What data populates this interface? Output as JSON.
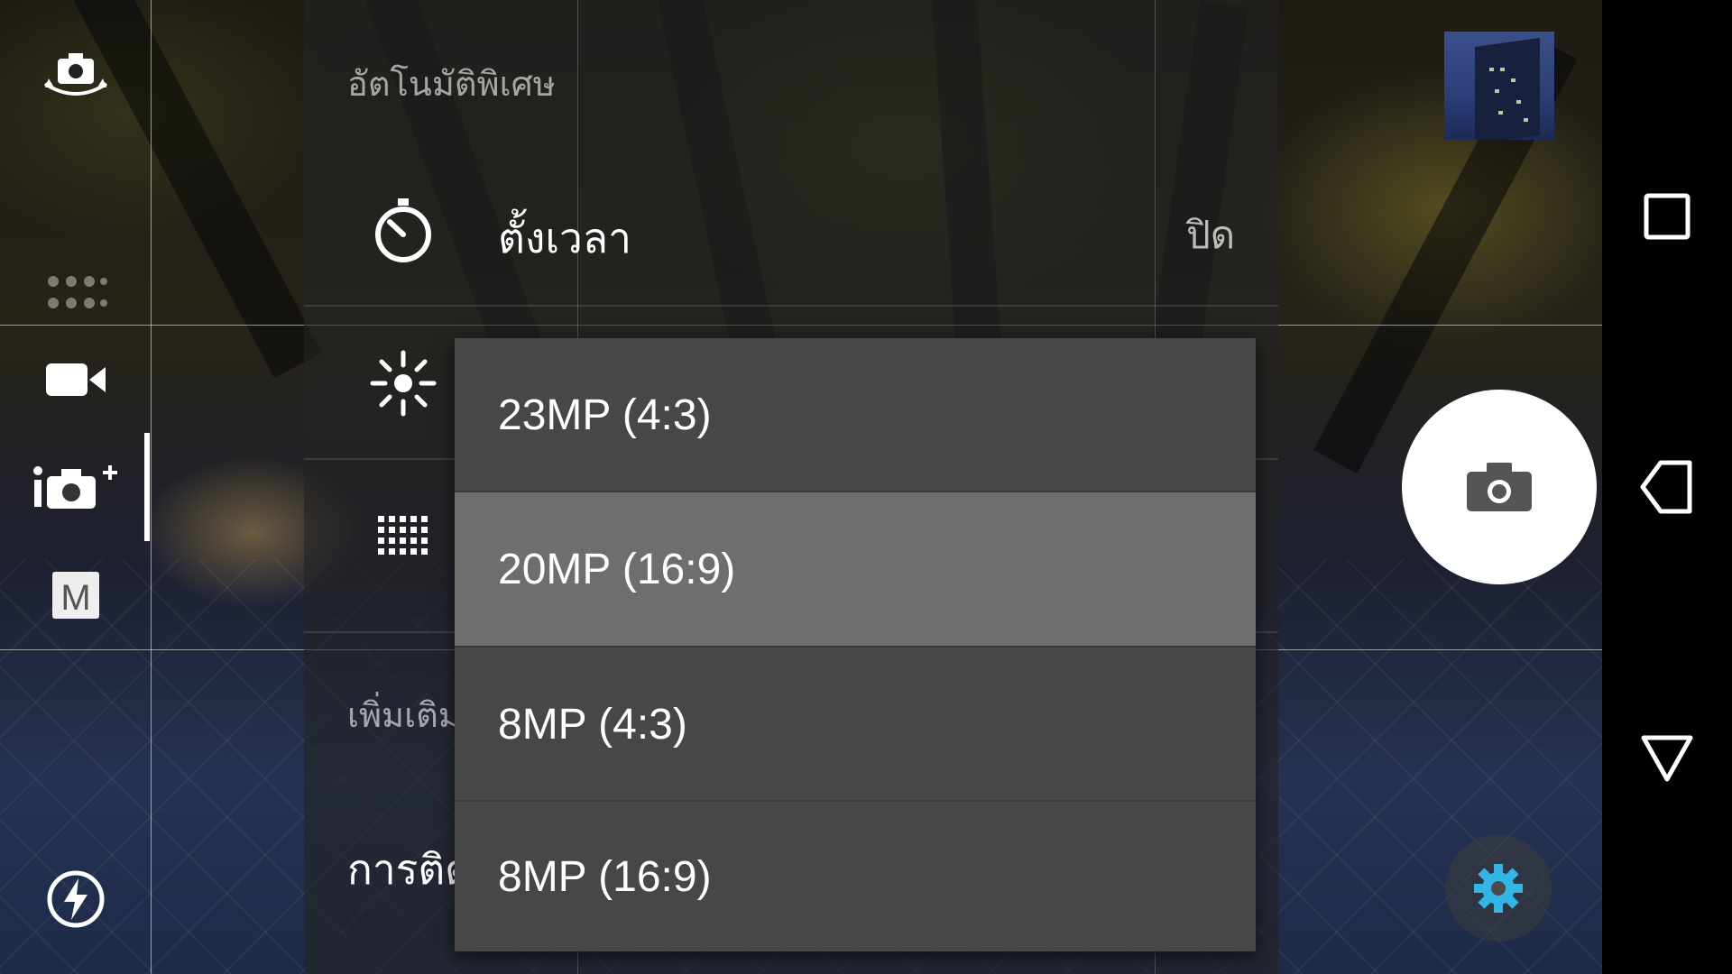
{
  "app": {
    "name": "Camera"
  },
  "rail": {
    "icons": [
      "switch-camera-icon",
      "grid-dots-icon",
      "video-mode-icon",
      "superior-auto-icon",
      "manual-mode-icon",
      "flash-auto-icon"
    ],
    "manual_label": "M"
  },
  "settings": {
    "section_superior_auto": "อัตโนมัติพิเศษ",
    "timer": {
      "label": "ตั้งเวลา",
      "value": "ปิด",
      "icon": "timer-icon"
    },
    "brightness_icon": "brightness-icon",
    "resolution_icon": "resolution-grid-icon",
    "section_more": "เพิ่มเติม",
    "more_item": "การติดตั้ง"
  },
  "resolution_popup": {
    "options": [
      "23MP (4:3)",
      "20MP (16:9)",
      "8MP (4:3)",
      "8MP (16:9)"
    ],
    "selected_index": 1
  },
  "controls": {
    "thumbnail": "last-photo-thumbnail",
    "shutter_icon": "camera-shutter-icon",
    "settings_icon": "gear-icon",
    "settings_color": "#33b5e5"
  },
  "nav": {
    "recents": "recents-icon",
    "back": "back-icon",
    "home": "home-icon"
  }
}
